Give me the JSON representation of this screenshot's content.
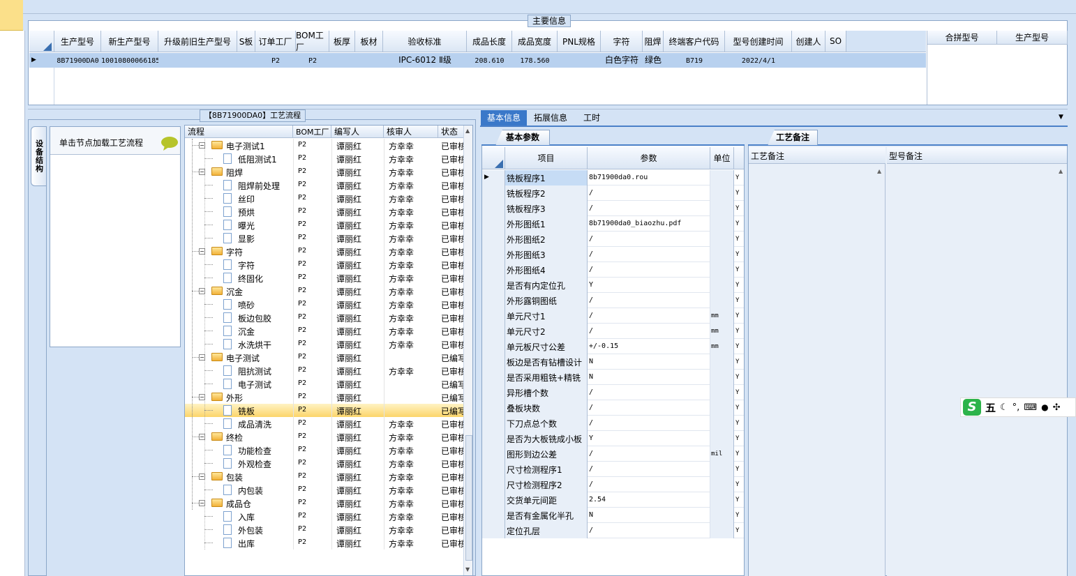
{
  "main_info": {
    "title": "主要信息",
    "columns": [
      "生产型号",
      "新生产型号",
      "升级前旧生产型号",
      "S板",
      "订单工厂",
      "BOM工厂",
      "板厚",
      "板材",
      "验收标准",
      "成品长度",
      "成品宽度",
      "PNL规格",
      "字符",
      "阻焊",
      "终端客户代码",
      "型号创建时间",
      "创建人",
      "SO"
    ],
    "row": [
      "8B71900DA0",
      "10010800066185",
      "",
      "",
      "P2",
      "P2",
      "",
      "",
      "IPC-6012 Ⅱ级",
      "208.610",
      "178.560",
      "",
      "白色字符",
      "绿色",
      "B719",
      "2022/4/1",
      "",
      ""
    ],
    "merge_columns": [
      "合拼型号",
      "生产型号"
    ]
  },
  "left_panel": {
    "vertical_tab": "设备结构",
    "hint": "单击节点加载工艺流程"
  },
  "process": {
    "title": "【8B71900DA0】工艺流程",
    "columns": [
      "流程",
      "BOM工厂",
      "编写人",
      "核审人",
      "状态"
    ],
    "rows": [
      {
        "name": "电子测试1",
        "level": 0,
        "bom": "P2",
        "writer": "谭丽红",
        "reviewer": "方幸幸",
        "status": "已审核"
      },
      {
        "name": "低阻测试1",
        "level": 1,
        "bom": "P2",
        "writer": "谭丽红",
        "reviewer": "方幸幸",
        "status": "已审核"
      },
      {
        "name": "阻焊",
        "level": 0,
        "bom": "P2",
        "writer": "谭丽红",
        "reviewer": "方幸幸",
        "status": "已审核"
      },
      {
        "name": "阻焊前处理",
        "level": 1,
        "bom": "P2",
        "writer": "谭丽红",
        "reviewer": "方幸幸",
        "status": "已审核"
      },
      {
        "name": "丝印",
        "level": 1,
        "bom": "P2",
        "writer": "谭丽红",
        "reviewer": "方幸幸",
        "status": "已审核"
      },
      {
        "name": "预烘",
        "level": 1,
        "bom": "P2",
        "writer": "谭丽红",
        "reviewer": "方幸幸",
        "status": "已审核"
      },
      {
        "name": "曝光",
        "level": 1,
        "bom": "P2",
        "writer": "谭丽红",
        "reviewer": "方幸幸",
        "status": "已审核"
      },
      {
        "name": "显影",
        "level": 1,
        "bom": "P2",
        "writer": "谭丽红",
        "reviewer": "方幸幸",
        "status": "已审核"
      },
      {
        "name": "字符",
        "level": 0,
        "bom": "P2",
        "writer": "谭丽红",
        "reviewer": "方幸幸",
        "status": "已审核"
      },
      {
        "name": "字符",
        "level": 1,
        "bom": "P2",
        "writer": "谭丽红",
        "reviewer": "方幸幸",
        "status": "已审核"
      },
      {
        "name": "终固化",
        "level": 1,
        "bom": "P2",
        "writer": "谭丽红",
        "reviewer": "方幸幸",
        "status": "已审核"
      },
      {
        "name": "沉金",
        "level": 0,
        "bom": "P2",
        "writer": "谭丽红",
        "reviewer": "方幸幸",
        "status": "已审核"
      },
      {
        "name": "喷砂",
        "level": 1,
        "bom": "P2",
        "writer": "谭丽红",
        "reviewer": "方幸幸",
        "status": "已审核"
      },
      {
        "name": "板边包胶",
        "level": 1,
        "bom": "P2",
        "writer": "谭丽红",
        "reviewer": "方幸幸",
        "status": "已审核"
      },
      {
        "name": "沉金",
        "level": 1,
        "bom": "P2",
        "writer": "谭丽红",
        "reviewer": "方幸幸",
        "status": "已审核"
      },
      {
        "name": "水洗烘干",
        "level": 1,
        "bom": "P2",
        "writer": "谭丽红",
        "reviewer": "方幸幸",
        "status": "已审核"
      },
      {
        "name": "电子测试",
        "level": 0,
        "bom": "P2",
        "writer": "谭丽红",
        "reviewer": "",
        "status": "已编写"
      },
      {
        "name": "阻抗测试",
        "level": 1,
        "bom": "P2",
        "writer": "谭丽红",
        "reviewer": "方幸幸",
        "status": "已审核"
      },
      {
        "name": "电子测试",
        "level": 1,
        "bom": "P2",
        "writer": "谭丽红",
        "reviewer": "",
        "status": "已编写"
      },
      {
        "name": "外形",
        "level": 0,
        "bom": "P2",
        "writer": "谭丽红",
        "reviewer": "",
        "status": "已编写"
      },
      {
        "name": "铣板",
        "level": 1,
        "bom": "P2",
        "writer": "谭丽红",
        "reviewer": "",
        "status": "已编写",
        "selected": true
      },
      {
        "name": "成品清洗",
        "level": 1,
        "bom": "P2",
        "writer": "谭丽红",
        "reviewer": "方幸幸",
        "status": "已审核"
      },
      {
        "name": "终检",
        "level": 0,
        "bom": "P2",
        "writer": "谭丽红",
        "reviewer": "方幸幸",
        "status": "已审核"
      },
      {
        "name": "功能检查",
        "level": 1,
        "bom": "P2",
        "writer": "谭丽红",
        "reviewer": "方幸幸",
        "status": "已审核"
      },
      {
        "name": "外观检查",
        "level": 1,
        "bom": "P2",
        "writer": "谭丽红",
        "reviewer": "方幸幸",
        "status": "已审核"
      },
      {
        "name": "包装",
        "level": 0,
        "bom": "P2",
        "writer": "谭丽红",
        "reviewer": "方幸幸",
        "status": "已审核"
      },
      {
        "name": "内包装",
        "level": 1,
        "bom": "P2",
        "writer": "谭丽红",
        "reviewer": "方幸幸",
        "status": "已审核"
      },
      {
        "name": "成品仓",
        "level": 0,
        "bom": "P2",
        "writer": "谭丽红",
        "reviewer": "方幸幸",
        "status": "已审核"
      },
      {
        "name": "入库",
        "level": 1,
        "bom": "P2",
        "writer": "谭丽红",
        "reviewer": "方幸幸",
        "status": "已审核"
      },
      {
        "name": "外包装",
        "level": 1,
        "bom": "P2",
        "writer": "谭丽红",
        "reviewer": "方幸幸",
        "status": "已审核"
      },
      {
        "name": "出库",
        "level": 1,
        "bom": "P2",
        "writer": "谭丽红",
        "reviewer": "方幸幸",
        "status": "已审核"
      }
    ]
  },
  "tabs": [
    "基本信息",
    "拓展信息",
    "工时"
  ],
  "basic": {
    "title": "基本参数",
    "columns": [
      "项目",
      "参数",
      "单位"
    ],
    "rows": [
      {
        "item": "铣板程序1",
        "value": "8b71900da0.rou",
        "unit": "",
        "flag": "Y"
      },
      {
        "item": "铣板程序2",
        "value": "/",
        "unit": "",
        "flag": "Y"
      },
      {
        "item": "铣板程序3",
        "value": "/",
        "unit": "",
        "flag": "Y"
      },
      {
        "item": "外形图纸1",
        "value": "8b71900da0_biaozhu.pdf",
        "unit": "",
        "flag": "Y"
      },
      {
        "item": "外形图纸2",
        "value": "/",
        "unit": "",
        "flag": "Y"
      },
      {
        "item": "外形图纸3",
        "value": "/",
        "unit": "",
        "flag": "Y"
      },
      {
        "item": "外形图纸4",
        "value": "/",
        "unit": "",
        "flag": "Y"
      },
      {
        "item": "是否有内定位孔",
        "value": "Y",
        "unit": "",
        "flag": "Y"
      },
      {
        "item": "外形露铜图纸",
        "value": "/",
        "unit": "",
        "flag": "Y"
      },
      {
        "item": "单元尺寸1",
        "value": "/",
        "unit": "mm",
        "flag": "Y"
      },
      {
        "item": "单元尺寸2",
        "value": "/",
        "unit": "mm",
        "flag": "Y"
      },
      {
        "item": "单元板尺寸公差",
        "value": "+/-0.15",
        "unit": "mm",
        "flag": "Y"
      },
      {
        "item": "板边是否有钻槽设计",
        "value": "N",
        "unit": "",
        "flag": "Y"
      },
      {
        "item": "是否采用粗铣+精铣",
        "value": "N",
        "unit": "",
        "flag": "Y"
      },
      {
        "item": "异形槽个数",
        "value": "/",
        "unit": "",
        "flag": "Y"
      },
      {
        "item": "叠板块数",
        "value": "/",
        "unit": "",
        "flag": "Y"
      },
      {
        "item": "下刀点总个数",
        "value": "/",
        "unit": "",
        "flag": "Y"
      },
      {
        "item": "是否为大板铣成小板",
        "value": "Y",
        "unit": "",
        "flag": "Y"
      },
      {
        "item": "图形到边公差",
        "value": "/",
        "unit": "mil",
        "flag": "Y"
      },
      {
        "item": "尺寸检测程序1",
        "value": "/",
        "unit": "",
        "flag": "Y"
      },
      {
        "item": "尺寸检测程序2",
        "value": "/",
        "unit": "",
        "flag": "Y"
      },
      {
        "item": "交货单元间距",
        "value": "2.54",
        "unit": "",
        "flag": "Y"
      },
      {
        "item": "是否有金属化半孔",
        "value": "N",
        "unit": "",
        "flag": "Y"
      },
      {
        "item": "定位孔层",
        "value": "/",
        "unit": "",
        "flag": "Y"
      }
    ]
  },
  "notes": {
    "title": "工艺备注",
    "col1": "工艺备注",
    "col2": "型号备注"
  },
  "ime": {
    "label": "五"
  }
}
